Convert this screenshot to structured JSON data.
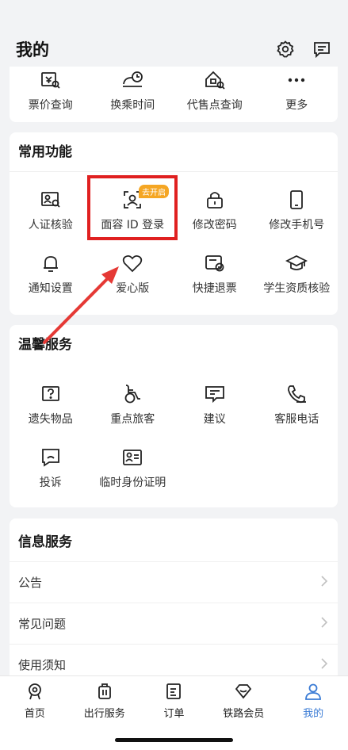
{
  "header": {
    "title": "我的"
  },
  "top_row": [
    {
      "label": "票价查询",
      "icon": "ticket-price-icon"
    },
    {
      "label": "换乘时间",
      "icon": "transfer-time-icon"
    },
    {
      "label": "代售点查询",
      "icon": "agency-search-icon"
    },
    {
      "label": "更多",
      "icon": "more-icon"
    }
  ],
  "common": {
    "title": "常用功能",
    "items": [
      {
        "label": "人证核验",
        "icon": "id-verify-icon"
      },
      {
        "label": "面容 ID 登录",
        "icon": "face-id-icon",
        "badge": "去开启"
      },
      {
        "label": "修改密码",
        "icon": "lock-icon"
      },
      {
        "label": "修改手机号",
        "icon": "phone-icon"
      },
      {
        "label": "通知设置",
        "icon": "bell-icon"
      },
      {
        "label": "爱心版",
        "icon": "heart-icon"
      },
      {
        "label": "快捷退票",
        "icon": "quick-refund-icon"
      },
      {
        "label": "学生资质核验",
        "icon": "student-cap-icon"
      }
    ]
  },
  "warm": {
    "title": "温馨服务",
    "items": [
      {
        "label": "遗失物品",
        "icon": "lost-item-icon"
      },
      {
        "label": "重点旅客",
        "icon": "wheelchair-icon"
      },
      {
        "label": "建议",
        "icon": "suggestion-icon"
      },
      {
        "label": "客服电话",
        "icon": "phone-call-icon"
      },
      {
        "label": "投诉",
        "icon": "complaint-icon"
      },
      {
        "label": "临时身份证明",
        "icon": "temp-id-icon"
      }
    ]
  },
  "info": {
    "title": "信息服务",
    "rows": [
      {
        "label": "公告"
      },
      {
        "label": "常见问题"
      },
      {
        "label": "使用须知"
      }
    ]
  },
  "tabs": [
    {
      "label": "首页",
      "icon": "home-icon"
    },
    {
      "label": "出行服务",
      "icon": "luggage-icon"
    },
    {
      "label": "订单",
      "icon": "order-icon"
    },
    {
      "label": "铁路会员",
      "icon": "diamond-icon"
    },
    {
      "label": "我的",
      "icon": "person-icon",
      "active": true
    }
  ],
  "colors": {
    "accent": "#3a7bd5",
    "highlight": "#e02020",
    "badge": "#f5a623"
  }
}
